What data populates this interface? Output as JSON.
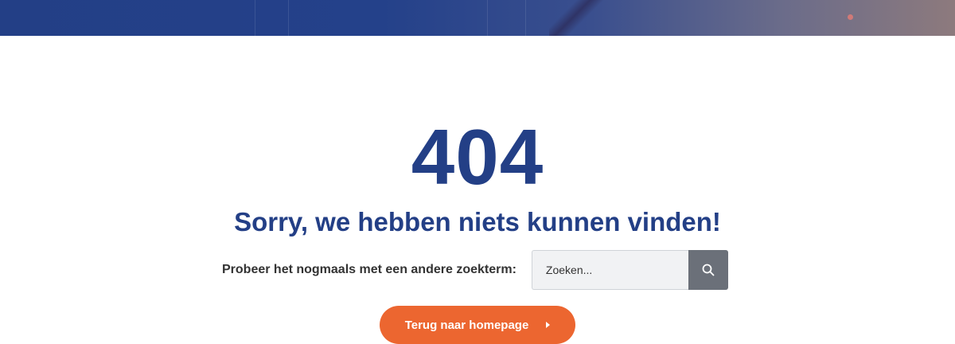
{
  "banner": {
    "accent": "#233f86"
  },
  "error": {
    "code": "404",
    "heading": "Sorry, we hebben niets kunnen vinden!"
  },
  "search": {
    "prompt": "Probeer het nogmaals met een andere zoekterm:",
    "placeholder": "Zoeken...",
    "button_icon": "search-icon"
  },
  "home_button": {
    "label": "Terug naar homepage",
    "icon": "caret-right-icon",
    "color": "#ec6630"
  }
}
